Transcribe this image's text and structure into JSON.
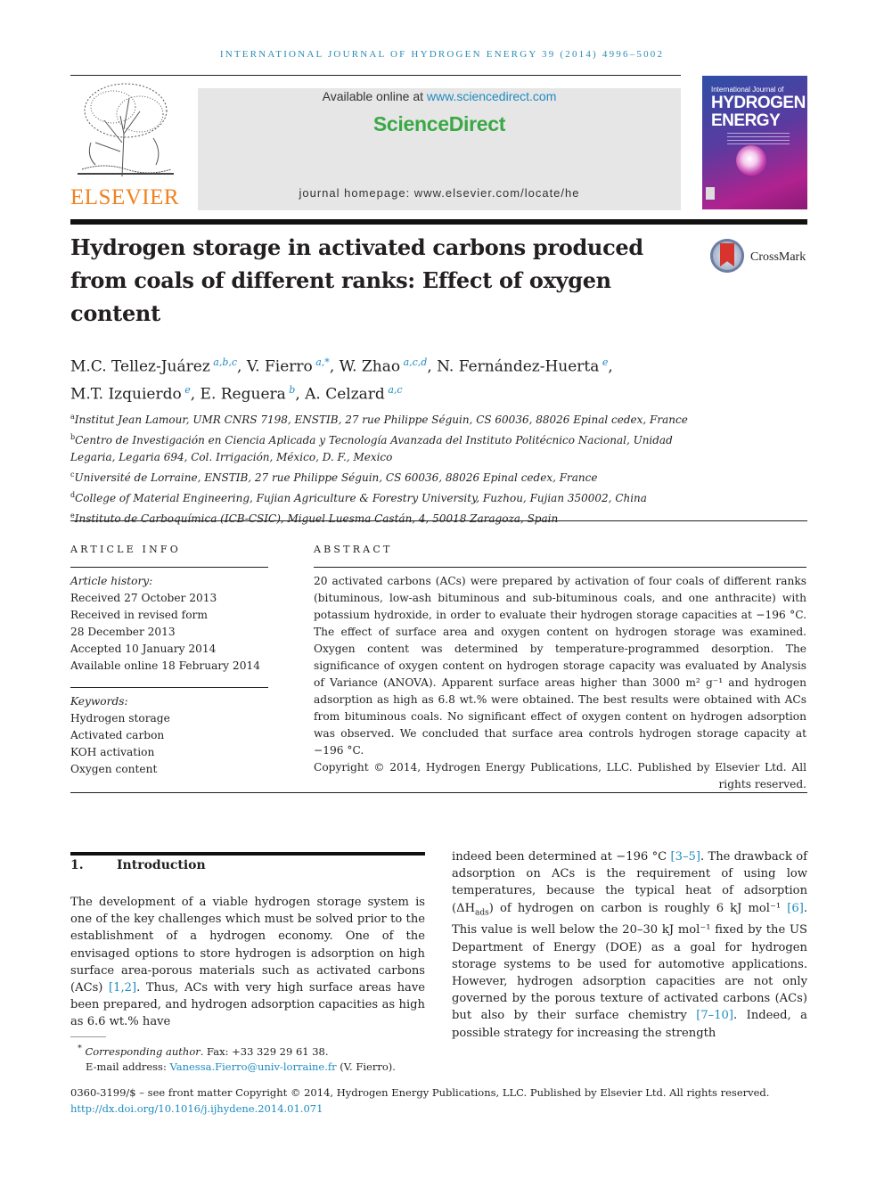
{
  "running_head": "INTERNATIONAL JOURNAL OF HYDROGEN ENERGY 39 (2014) 4996–5002",
  "publisher": {
    "name": "ELSEVIER"
  },
  "sciencedirect": {
    "available_prefix": "Available online at ",
    "available_link": "www.sciencedirect.com",
    "logo": "ScienceDirect",
    "homepage": "journal homepage: www.elsevier.com/locate/he"
  },
  "cover": {
    "line1": "International Journal of",
    "line2": "HYDROGEN",
    "line3": "ENERGY"
  },
  "crossmark": {
    "label": "CrossMark"
  },
  "title": "Hydrogen storage in activated carbons produced from coals of different ranks: Effect of oxygen content",
  "authors": [
    {
      "name": "M.C. Tellez-Juárez",
      "aff": "a,b,c",
      "sep": ", "
    },
    {
      "name": "V. Fierro",
      "aff": "a,*",
      "sep": ", "
    },
    {
      "name": "W. Zhao",
      "aff": "a,c,d",
      "sep": ", "
    },
    {
      "name": "N. Fernández-Huerta",
      "aff": "e",
      "sep": ","
    },
    {
      "name": "M.T. Izquierdo",
      "aff": "e",
      "sep": ", "
    },
    {
      "name": "E. Reguera",
      "aff": "b",
      "sep": ", "
    },
    {
      "name": "A. Celzard",
      "aff": "a,c",
      "sep": ""
    }
  ],
  "affiliations": [
    {
      "key": "a",
      "text": "Institut Jean Lamour, UMR CNRS 7198, ENSTIB, 27 rue Philippe Séguin, CS 60036, 88026 Epinal cedex, France"
    },
    {
      "key": "b",
      "text": "Centro de Investigación en Ciencia Aplicada y Tecnología Avanzada del Instituto Politécnico Nacional, Unidad Legaria, Legaria 694, Col. Irrigación, México, D. F., Mexico"
    },
    {
      "key": "c",
      "text": "Université de Lorraine, ENSTIB, 27 rue Philippe Séguin, CS 60036, 88026 Epinal cedex, France"
    },
    {
      "key": "d",
      "text": "College of Material Engineering, Fujian Agriculture & Forestry University, Fuzhou, Fujian 350002, China"
    },
    {
      "key": "e",
      "text": "Instituto de Carboquímica (ICB-CSIC), Miguel Luesma Castán, 4, 50018 Zaragoza, Spain"
    }
  ],
  "article_info": {
    "heading": "ARTICLE INFO",
    "history_label": "Article history:",
    "history": [
      "Received 27 October 2013",
      "Received in revised form",
      "28 December 2013",
      "Accepted 10 January 2014",
      "Available online 18 February 2014"
    ],
    "keywords_label": "Keywords:",
    "keywords": [
      "Hydrogen storage",
      "Activated carbon",
      "KOH activation",
      "Oxygen content"
    ]
  },
  "abstract": {
    "heading": "ABSTRACT",
    "p1": "20 activated carbons (ACs) were prepared by activation of four coals of different ranks (bituminous, low-ash bituminous and sub-bituminous coals, and one anthracite) with potassium hydroxide, in order to evaluate their hydrogen storage capacities at −196 °C. The effect of surface area and oxygen content on hydrogen storage was examined. Oxygen content was determined by temperature-programmed desorption. The significance of oxygen content on hydrogen storage capacity was evaluated by Analysis of Variance (ANOVA). Apparent surface areas higher than 3000 m² g⁻¹ and hydrogen adsorption as high as 6.8 wt.% were obtained. The best results were obtained with ACs from bituminous coals. No significant effect of oxygen content on hydrogen adsorption was observed. We concluded that surface area controls hydrogen storage capacity at −196 °C.",
    "copyright": "Copyright © 2014, Hydrogen Energy Publications, LLC. Published by Elsevier Ltd. All rights reserved."
  },
  "section1": {
    "number": "1.",
    "title": "Introduction",
    "col1_a": "The development of a viable hydrogen storage system is one of the key challenges which must be solved prior to the establishment of a hydrogen economy. One of the envisaged options to store hydrogen is adsorption on high surface area-porous materials such as activated carbons (ACs) ",
    "col1_cite1": "[1,2]",
    "col1_b": ". Thus, ACs with very high surface areas have been prepared, and hydrogen adsorption capacities as high as 6.6 wt.% have",
    "col2_a": "indeed been determined at −196 °C ",
    "col2_cite1": "[3–5]",
    "col2_b": ". The drawback of adsorption on ACs is the requirement of using low temperatures, because the typical heat of adsorption (ΔH",
    "col2_sub": "ads",
    "col2_c": ") of hydrogen on carbon is roughly 6 kJ mol⁻¹ ",
    "col2_cite2": "[6]",
    "col2_d": ". This value is well below the 20–30 kJ mol⁻¹ fixed by the US Department of Energy (DOE) as a goal for hydrogen storage systems to be used for automotive applications. However, hydrogen adsorption capacities are not only governed by the porous texture of activated carbons (ACs) but also by their surface chemistry ",
    "col2_cite3": "[7–10]",
    "col2_e": ". Indeed, a possible strategy for increasing the strength"
  },
  "footnote": {
    "mark": "*",
    "label": "Corresponding author",
    "fax": ". Fax: +33 329 29 61 38.",
    "email_label": "E-mail address: ",
    "email": "Vanessa.Fierro@univ-lorraine.fr",
    "email_suffix": " (V. Fierro)."
  },
  "bottom": {
    "issn": "0360-3199/$ – see front matter Copyright © 2014, Hydrogen Energy Publications, LLC. Published by Elsevier Ltd. All rights reserved.",
    "doi": "http://dx.doi.org/10.1016/j.ijhydene.2014.01.071"
  }
}
